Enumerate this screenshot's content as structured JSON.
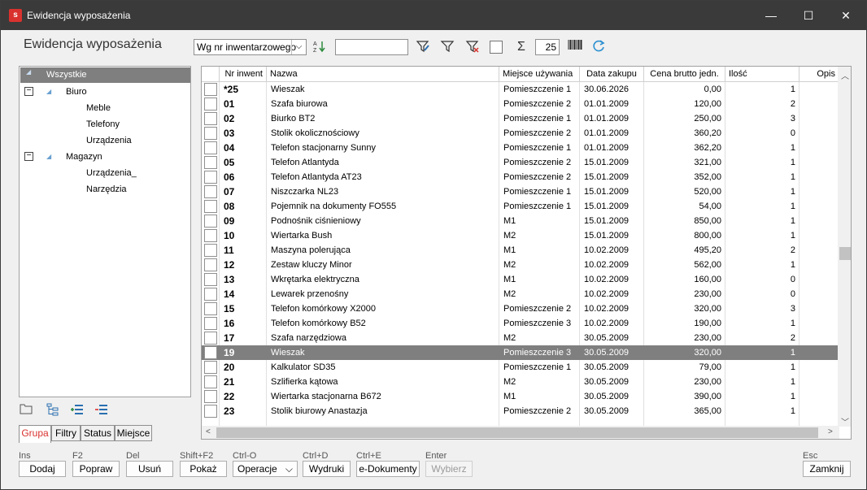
{
  "window": {
    "title": "Ewidencja wyposażenia",
    "minimize": "—",
    "maximize": "☐",
    "close": "✕"
  },
  "module_title": "Ewidencja wyposażenia",
  "toolbar": {
    "sort_select": "Wg nr inwentarzowego",
    "search_value": "",
    "count_value": "25"
  },
  "tree": {
    "items": [
      {
        "label": "Wszystkie"
      },
      {
        "label": "Biuro"
      },
      {
        "label": "Meble"
      },
      {
        "label": "Telefony"
      },
      {
        "label": "Urządzenia"
      },
      {
        "label": "Magazyn"
      },
      {
        "label": "Urządzenia_"
      },
      {
        "label": "Narzędzia"
      }
    ]
  },
  "tabs": [
    {
      "label": "Grupa"
    },
    {
      "label": "Filtry"
    },
    {
      "label": "Status"
    },
    {
      "label": "Miejsce"
    }
  ],
  "grid": {
    "columns": [
      "Nr inwent",
      "Nazwa",
      "Miejsce używania",
      "Data zakupu",
      "Cena brutto jedn.",
      "Ilość",
      "Opis"
    ],
    "rows": [
      [
        "*25",
        "Wieszak",
        "Pomieszczenie 1",
        "30.06.2026",
        "0,00",
        "1"
      ],
      [
        "01",
        "Szafa biurowa",
        "Pomieszczenie 2",
        "01.01.2009",
        "120,00",
        "2"
      ],
      [
        "02",
        "Biurko BT2",
        "Pomieszczenie 1",
        "01.01.2009",
        "250,00",
        "3"
      ],
      [
        "03",
        "Stolik okolicznościowy",
        "Pomieszczenie 2",
        "01.01.2009",
        "360,20",
        "0"
      ],
      [
        "04",
        "Telefon stacjonarny Sunny",
        "Pomieszczenie 1",
        "01.01.2009",
        "362,20",
        "1"
      ],
      [
        "05",
        "Telefon Atlantyda",
        "Pomieszczenie 2",
        "15.01.2009",
        "321,00",
        "1"
      ],
      [
        "06",
        "Telefon  Atlantyda AT23",
        "Pomieszczenie 2",
        "15.01.2009",
        "352,00",
        "1"
      ],
      [
        "07",
        "Niszczarka NL23",
        "Pomieszczenie 1",
        "15.01.2009",
        "520,00",
        "1"
      ],
      [
        "08",
        "Pojemnik na dokumenty FO555",
        "Pomieszczenie 1",
        "15.01.2009",
        "54,00",
        "1"
      ],
      [
        "09",
        "Podnośnik ciśnieniowy",
        "M1",
        "15.01.2009",
        "850,00",
        "1"
      ],
      [
        "10",
        "Wiertarka Bush",
        "M2",
        "15.01.2009",
        "800,00",
        "1"
      ],
      [
        "11",
        "Maszyna polerująca",
        "M1",
        "10.02.2009",
        "495,20",
        "2"
      ],
      [
        "12",
        "Zestaw kluczy Minor",
        "M2",
        "10.02.2009",
        "562,00",
        "1"
      ],
      [
        "13",
        "Wkrętarka elektryczna",
        "M1",
        "10.02.2009",
        "160,00",
        "0"
      ],
      [
        "14",
        "Lewarek przenośny",
        "M2",
        "10.02.2009",
        "230,00",
        "0"
      ],
      [
        "15",
        "Telefon komórkowy X2000",
        "Pomieszczenie 2",
        "10.02.2009",
        "320,00",
        "3"
      ],
      [
        "16",
        "Telefon komórkowy B52",
        "Pomieszczenie 3",
        "10.02.2009",
        "190,00",
        "1"
      ],
      [
        "17",
        "Szafa narzędziowa",
        "M2",
        "30.05.2009",
        "230,00",
        "2"
      ],
      [
        "19",
        "Wieszak",
        "Pomieszczenie 3",
        "30.05.2009",
        "320,00",
        "1"
      ],
      [
        "20",
        "Kalkulator SD35",
        "Pomieszczenie 1",
        "30.05.2009",
        "79,00",
        "1"
      ],
      [
        "21",
        "Szlifierka kątowa",
        "M2",
        "30.05.2009",
        "230,00",
        "1"
      ],
      [
        "22",
        "Wiertarka stacjonarna B672",
        "M1",
        "30.05.2009",
        "390,00",
        "1"
      ],
      [
        "23",
        "Stolik biurowy Anastazja",
        "Pomieszczenie 2",
        "30.05.2009",
        "365,00",
        "1"
      ]
    ],
    "selected_row": 18
  },
  "actions": [
    {
      "shortcut": "Ins",
      "label": "Dodaj"
    },
    {
      "shortcut": "F2",
      "label": "Popraw"
    },
    {
      "shortcut": "Del",
      "label": "Usuń"
    },
    {
      "shortcut": "Shift+F2",
      "label": "Pokaż"
    },
    {
      "shortcut": "Ctrl-O",
      "label": "Operacje"
    },
    {
      "shortcut": "Ctrl+D",
      "label": "Wydruki"
    },
    {
      "shortcut": "Ctrl+E",
      "label": "e-Dokumenty"
    },
    {
      "shortcut": "Enter",
      "label": "Wybierz"
    },
    {
      "shortcut": "Esc",
      "label": "Zamknij"
    }
  ]
}
